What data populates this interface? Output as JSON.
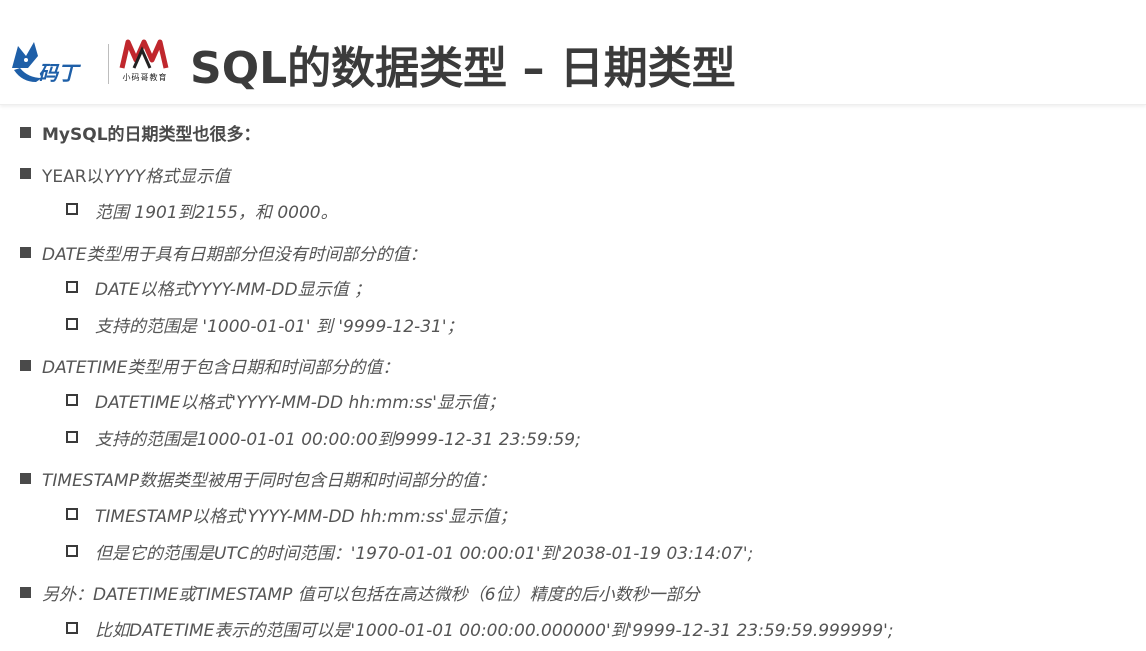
{
  "header": {
    "title": "SQL的数据类型 – 日期类型",
    "logo_left": "码丁",
    "logo_right_caption": "小码哥教育"
  },
  "items": [
    {
      "level": 1,
      "text": "MySQL的日期类型也很多："
    },
    {
      "level": 1,
      "prefix": "YEAR以",
      "text": "YYYY格式显示值"
    },
    {
      "level": 2,
      "text": "范围 1901到2155，和 0000。"
    },
    {
      "level": 1,
      "text": "DATE类型用于具有日期部分但没有时间部分的值："
    },
    {
      "level": 2,
      "text": "DATE以格式YYYY-MM-DD显示值 ；"
    },
    {
      "level": 2,
      "text": "支持的范围是 '1000-01-01' 到 '9999-12-31'；"
    },
    {
      "level": 1,
      "text": "DATETIME类型用于包含日期和时间部分的值："
    },
    {
      "level": 2,
      "text": "DATETIME以格式'YYYY-MM-DD hh:mm:ss'显示值；"
    },
    {
      "level": 2,
      "text": "支持的范围是1000-01-01 00:00:00到9999-12-31 23:59:59;"
    },
    {
      "level": 1,
      "text": "TIMESTAMP数据类型被用于同时包含日期和时间部分的值："
    },
    {
      "level": 2,
      "text": "TIMESTAMP以格式'YYYY-MM-DD hh:mm:ss'显示值；"
    },
    {
      "level": 2,
      "text": "但是它的范围是UTC的时间范围：'1970-01-01 00:00:01'到'2038-01-19 03:14:07';"
    },
    {
      "level": 1,
      "text": "另外：DATETIME或TIMESTAMP 值可以包括在高达微秒（6位）精度的后小数秒一部分"
    },
    {
      "level": 2,
      "text": "比如DATETIME表示的范围可以是'1000-01-01 00:00:00.000000'到'9999-12-31 23:59:59.999999';"
    }
  ],
  "colors": {
    "title": "#3b3b3b",
    "logo_blue": "#1e5fa8",
    "logo_red": "#c0272d"
  }
}
